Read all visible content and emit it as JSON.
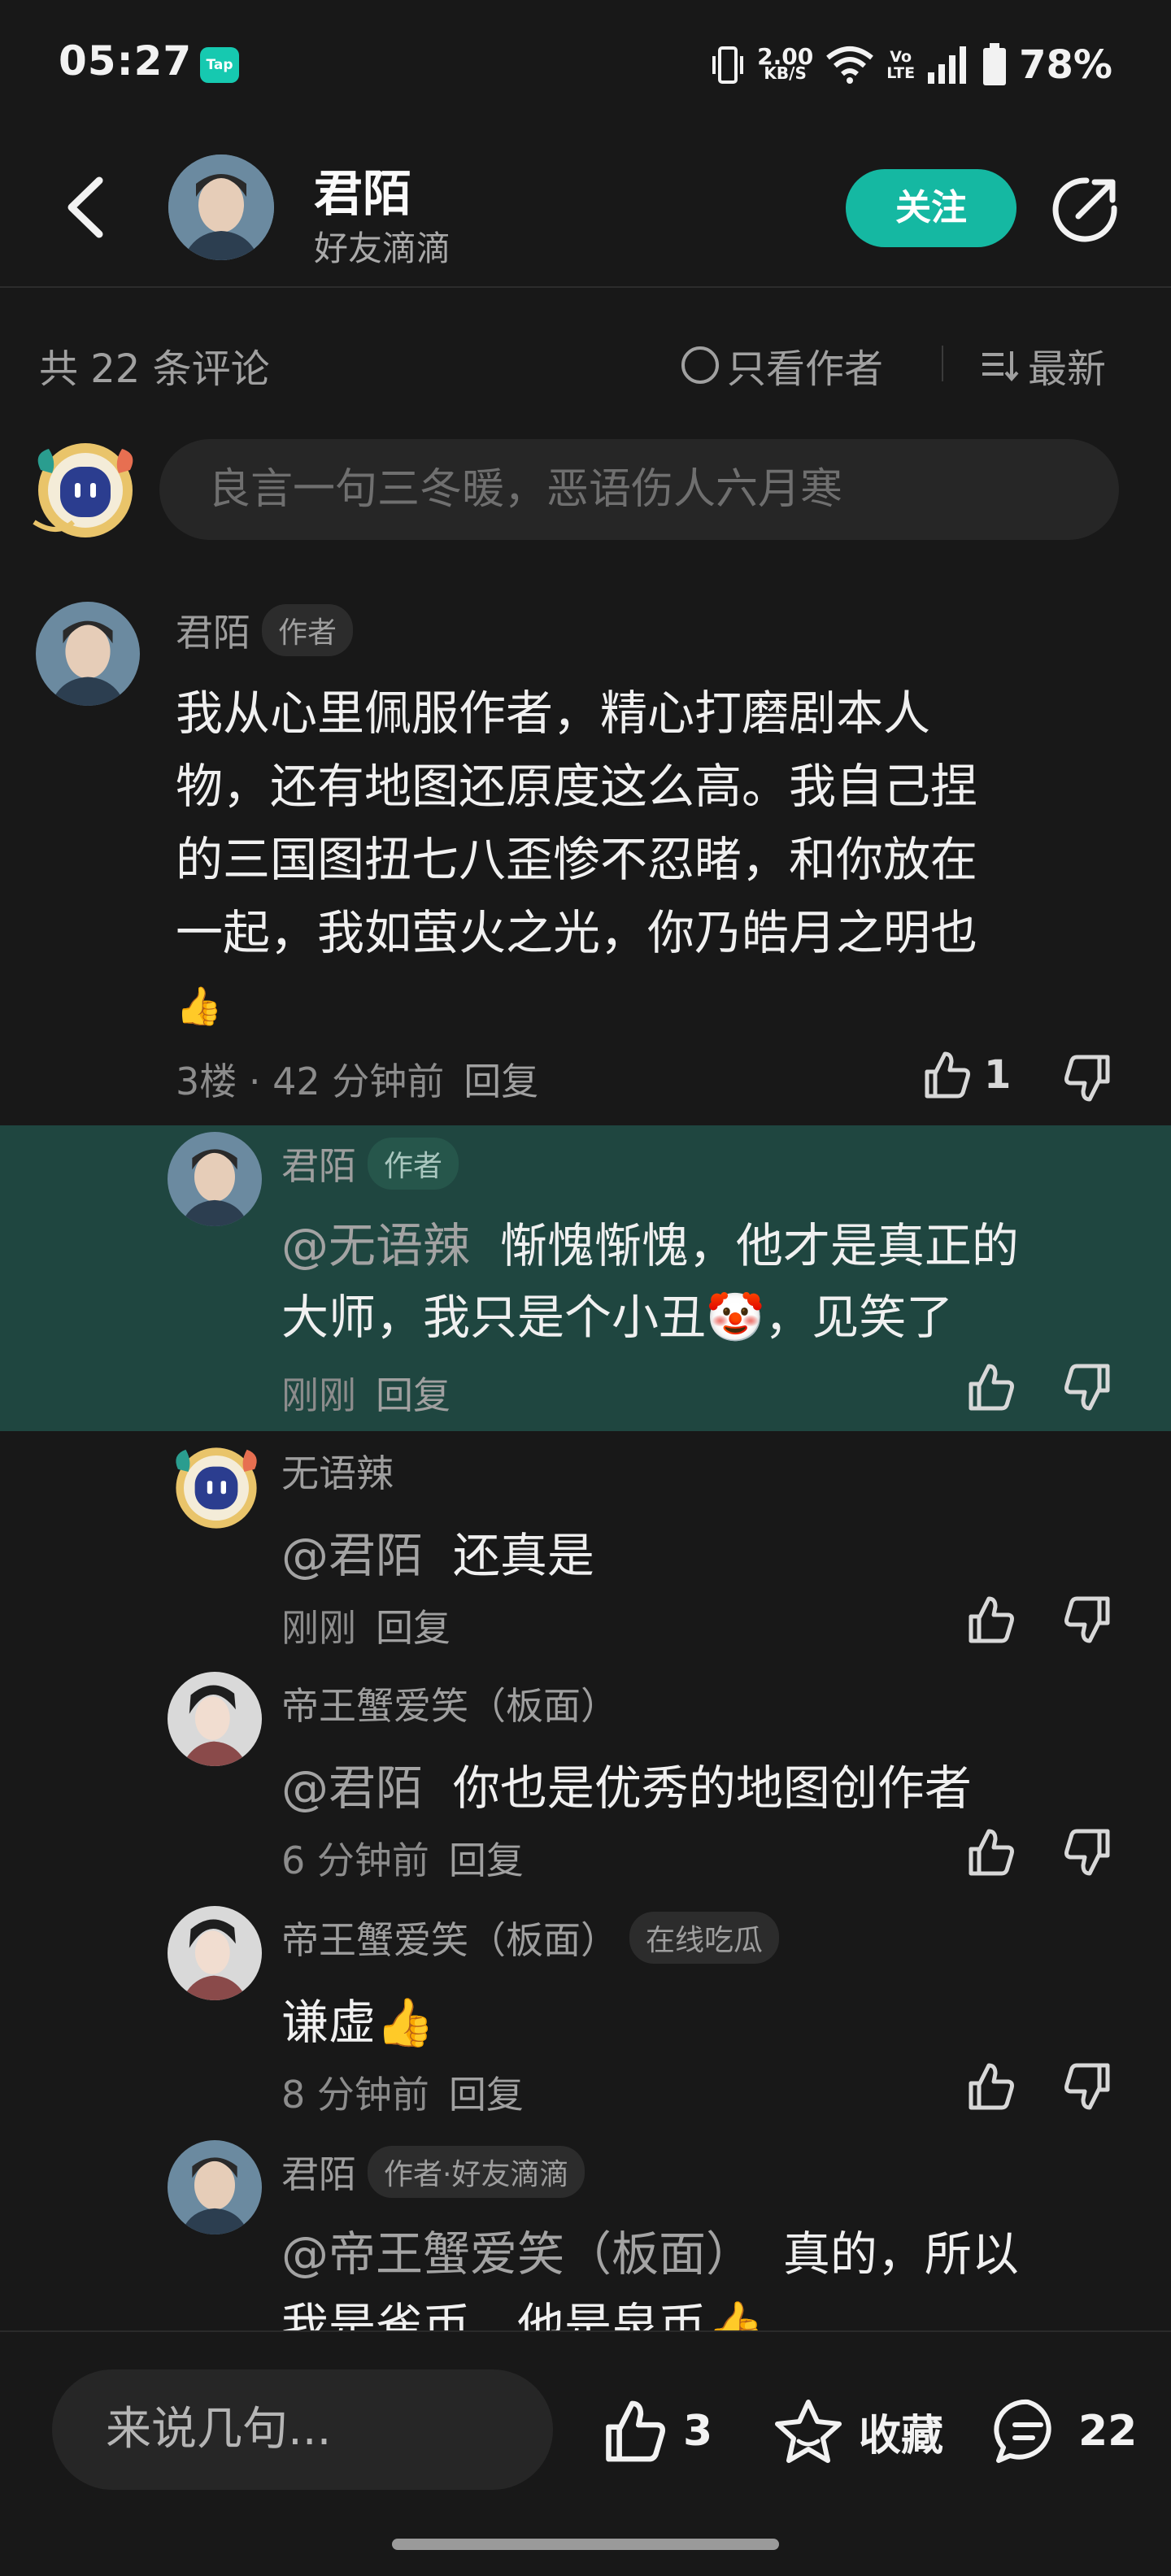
{
  "status_bar": {
    "time": "05:27",
    "tap_badge": "Tap",
    "net_speed_value": "2.00",
    "net_speed_unit": "KB/S",
    "volte_top": "Vo",
    "volte_bottom": "LTE",
    "battery": "78%"
  },
  "header": {
    "name": "君陌",
    "subtitle": "好友滴滴",
    "follow_label": "关注"
  },
  "toolbar": {
    "count_label": "共 22 条评论",
    "author_only_label": "只看作者",
    "sort_label": "最新"
  },
  "composer": {
    "placeholder": "良言一句三冬暖，恶语伤人六月寒"
  },
  "main_comment": {
    "user": "君陌",
    "tag": "作者",
    "lines": [
      "我从心里佩服作者，精心打磨剧本人",
      "物，还有地图还原度这么高。我自己捏",
      "的三国图扭七八歪惨不忍睹，和你放在",
      "一起，我如萤火之光，你乃皓月之明也"
    ],
    "emoji": "👍",
    "floor": "3楼 · 42 分钟前",
    "reply_label": "回复",
    "likes": "1"
  },
  "replies": [
    {
      "user": "君陌",
      "tag": "作者",
      "at": "@无语辣",
      "line1": "惭愧惭愧，他才是真正的",
      "line2": "大师，我只是个小丑🤡，见笑了",
      "time": "刚刚",
      "reply_label": "回复"
    },
    {
      "user": "无语辣",
      "at": "@君陌",
      "text": "还真是",
      "time": "刚刚",
      "reply_label": "回复"
    },
    {
      "user": "帝王蟹爱笑（板面）",
      "at": "@君陌",
      "text": "你也是优秀的地图创作者",
      "time": "6 分钟前",
      "reply_label": "回复"
    },
    {
      "user": "帝王蟹爱笑（板面）",
      "tag": "在线吃瓜",
      "text": "谦虚👍",
      "time": "8 分钟前",
      "reply_label": "回复"
    },
    {
      "user": "君陌",
      "tag": "作者·好友滴滴",
      "at": "@帝王蟹爱笑（板面）",
      "line1": "真的，所以",
      "line2": "我是雀币，他是泉币👍"
    }
  ],
  "bottom_bar": {
    "input_placeholder": "来说几句...",
    "likes": "3",
    "favorite_label": "收藏",
    "comments": "22"
  },
  "colors": {
    "background": "#181818",
    "accent": "#15b8a2",
    "highlight_row": "#1f4640"
  },
  "icons": [
    "back-icon",
    "share-icon",
    "thumb-up-icon",
    "thumb-down-icon",
    "star-icon",
    "comment-icon",
    "sort-icon"
  ]
}
